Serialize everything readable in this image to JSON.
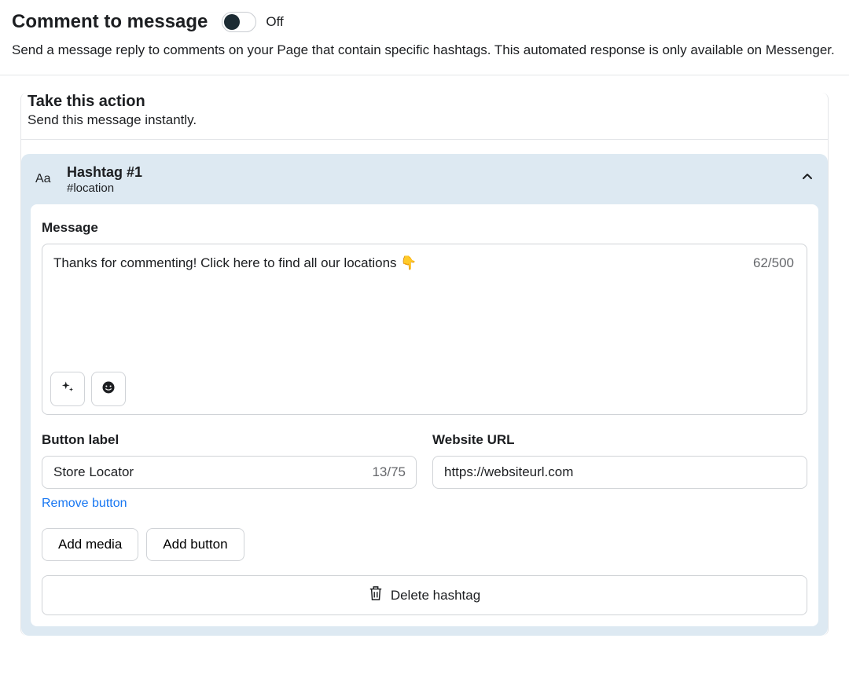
{
  "header": {
    "title": "Comment to message",
    "toggle_state": "Off",
    "desc": "Send a message reply to comments on your Page that contain specific hashtags. This automated response is only available on Messenger."
  },
  "action": {
    "title": "Take this action",
    "sub": "Send this message instantly."
  },
  "hashtag": {
    "icon_label": "Aa",
    "title": "Hashtag #1",
    "value": "#location",
    "message_label": "Message",
    "message_text": "Thanks for commenting! Click here to find all our locations 👇",
    "message_count": "62/500",
    "button_label_heading": "Button label",
    "button_label_value": "Store Locator",
    "button_label_count": "13/75",
    "url_heading": "Website URL",
    "url_value": "https://websiteurl.com",
    "remove_button": "Remove button",
    "add_media": "Add media",
    "add_button": "Add button",
    "delete_hashtag": "Delete hashtag"
  }
}
